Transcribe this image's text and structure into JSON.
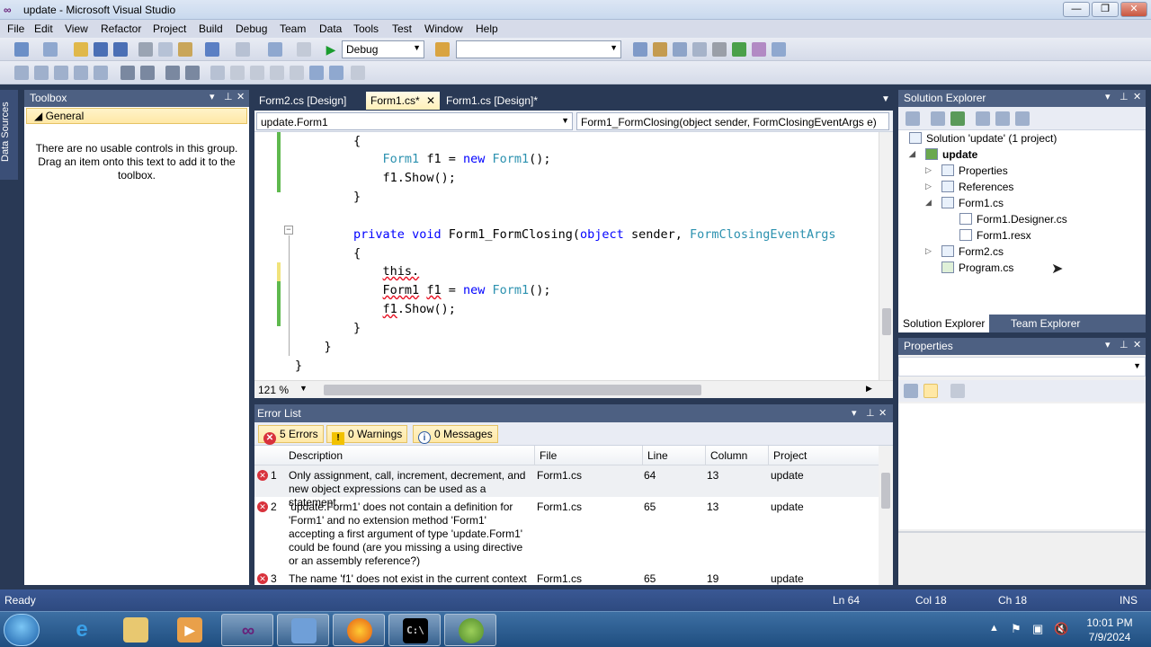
{
  "window": {
    "title": "update - Microsoft Visual Studio"
  },
  "menu": [
    "File",
    "Edit",
    "View",
    "Refactor",
    "Project",
    "Build",
    "Debug",
    "Team",
    "Data",
    "Tools",
    "Test",
    "Window",
    "Help"
  ],
  "toolbar": {
    "config": "Debug",
    "platform": ""
  },
  "side_strip": "Data Sources",
  "toolbox": {
    "title": "Toolbox",
    "group": "General",
    "message": "There are no usable controls in this group. Drag an item onto this text to add it to the toolbox."
  },
  "doc_tabs": [
    {
      "label": "Form2.cs [Design]"
    },
    {
      "label": "Form1.cs*"
    },
    {
      "label": "Form1.cs [Design]*"
    }
  ],
  "editor": {
    "class_combo": "update.Form1",
    "member_combo": "Form1_FormClosing(object sender, FormClosingEventArgs e)",
    "zoom": "121 %",
    "lines": [
      {
        "indent": "        ",
        "parts": [
          {
            "t": "{"
          }
        ]
      },
      {
        "indent": "            ",
        "parts": [
          {
            "t": "Form1",
            "c": "ty"
          },
          {
            "t": " f1 = "
          },
          {
            "t": "new",
            "c": "kw"
          },
          {
            "t": " "
          },
          {
            "t": "Form1",
            "c": "ty"
          },
          {
            "t": "();"
          }
        ]
      },
      {
        "indent": "            ",
        "parts": [
          {
            "t": "f1.Show();"
          }
        ]
      },
      {
        "indent": "        ",
        "parts": [
          {
            "t": "}"
          }
        ]
      },
      {
        "indent": "",
        "parts": [
          {
            "t": ""
          }
        ]
      },
      {
        "indent": "        ",
        "parts": [
          {
            "t": "private",
            "c": "kw"
          },
          {
            "t": " "
          },
          {
            "t": "void",
            "c": "kw"
          },
          {
            "t": " Form1_FormClosing("
          },
          {
            "t": "object",
            "c": "kw"
          },
          {
            "t": " sender, "
          },
          {
            "t": "FormClosingEventArgs",
            "c": "ty"
          }
        ]
      },
      {
        "indent": "        ",
        "parts": [
          {
            "t": "{"
          }
        ]
      },
      {
        "indent": "            ",
        "parts": [
          {
            "t": "this.",
            "c": "sq"
          }
        ]
      },
      {
        "indent": "            ",
        "parts": [
          {
            "t": "Form1",
            "c": "sq"
          },
          {
            "t": " "
          },
          {
            "t": "f1",
            "c": "sq"
          },
          {
            "t": " = "
          },
          {
            "t": "new",
            "c": "kw"
          },
          {
            "t": " "
          },
          {
            "t": "Form1",
            "c": "ty"
          },
          {
            "t": "();"
          }
        ]
      },
      {
        "indent": "            ",
        "parts": [
          {
            "t": "f1",
            "c": "sq"
          },
          {
            "t": ".Show();"
          }
        ]
      },
      {
        "indent": "        ",
        "parts": [
          {
            "t": "}"
          }
        ]
      },
      {
        "indent": "    ",
        "parts": [
          {
            "t": "}"
          }
        ]
      },
      {
        "indent": "",
        "parts": [
          {
            "t": "}"
          }
        ]
      }
    ]
  },
  "error_list": {
    "title": "Error List",
    "filters": {
      "errors": "5 Errors",
      "warnings": "0 Warnings",
      "messages": "0 Messages"
    },
    "columns": [
      "Description",
      "File",
      "Line",
      "Column",
      "Project"
    ],
    "rows": [
      {
        "n": "1",
        "desc": "Only assignment, call, increment, decrement, and new object expressions can be used as a statement",
        "file": "Form1.cs",
        "line": "64",
        "col": "13",
        "proj": "update"
      },
      {
        "n": "2",
        "desc": "'update.Form1' does not contain a definition for 'Form1' and no extension method 'Form1' accepting a first argument of type 'update.Form1' could be found (are you missing a using directive or an assembly reference?)",
        "file": "Form1.cs",
        "line": "65",
        "col": "13",
        "proj": "update"
      },
      {
        "n": "3",
        "desc": "The name 'f1' does not exist in the current context",
        "file": "Form1.cs",
        "line": "65",
        "col": "19",
        "proj": "update"
      }
    ]
  },
  "solution_explorer": {
    "title": "Solution Explorer",
    "nodes": [
      {
        "label": "Solution 'update' (1 project)",
        "exp": ""
      },
      {
        "label": "update",
        "exp": "◢"
      },
      {
        "label": "Properties",
        "exp": "▷"
      },
      {
        "label": "References",
        "exp": "▷"
      },
      {
        "label": "Form1.cs",
        "exp": "◢"
      },
      {
        "label": "Form1.Designer.cs",
        "exp": ""
      },
      {
        "label": "Form1.resx",
        "exp": ""
      },
      {
        "label": "Form2.cs",
        "exp": "▷"
      },
      {
        "label": "Program.cs",
        "exp": ""
      }
    ],
    "tabs": [
      "Solution Explorer",
      "Team Explorer"
    ]
  },
  "properties": {
    "title": "Properties"
  },
  "status": {
    "left": "Ready",
    "ln": "Ln 64",
    "col": "Col 18",
    "ch": "Ch 18",
    "mode": "INS"
  },
  "clock": {
    "time": "10:01 PM",
    "date": "7/9/2024"
  },
  "colors": {
    "accent": "#293955",
    "tab_active": "#fff0b8",
    "error": "#d8323c"
  }
}
